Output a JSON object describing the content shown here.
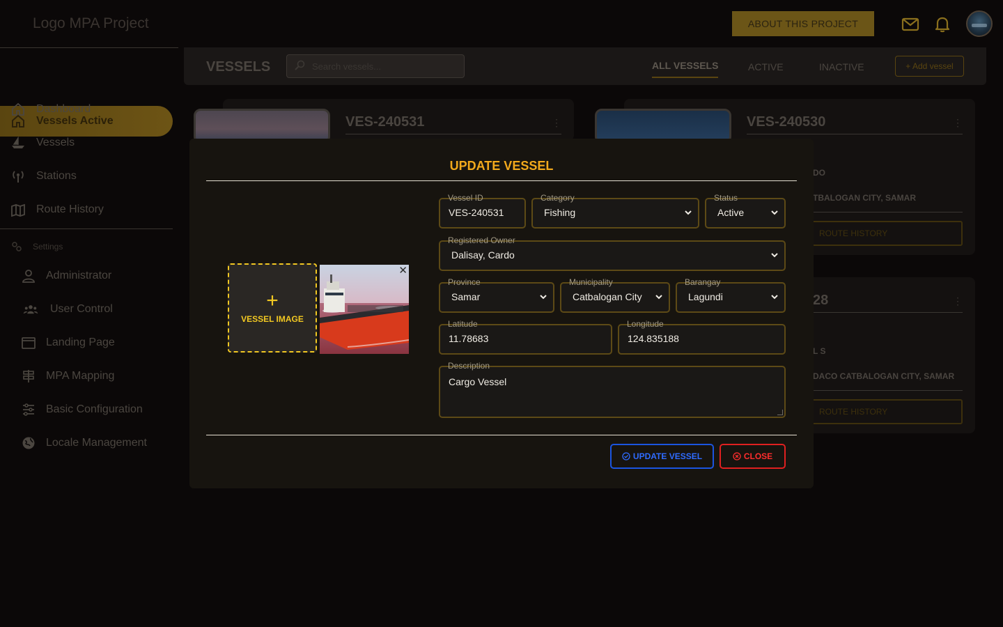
{
  "header": {
    "logo_text": "Logo MPA Project",
    "about_button": "ABOUT THIS PROJECT"
  },
  "sidebar": {
    "active_item": "Vessels Active",
    "items": [
      {
        "label": "Dashboard",
        "icon": "home-icon"
      },
      {
        "label": "Vessels",
        "icon": "ship-icon"
      },
      {
        "label": "Stations",
        "icon": "antenna-icon"
      },
      {
        "label": "Route History",
        "icon": "map-icon"
      }
    ],
    "settings_label": "Settings",
    "settings_items": [
      {
        "label": "Administrator",
        "icon": "user-icon"
      },
      {
        "label": "User Control",
        "icon": "users-icon"
      },
      {
        "label": "Landing Page",
        "icon": "window-icon"
      },
      {
        "label": "MPA Mapping",
        "icon": "signpost-icon"
      },
      {
        "label": "Basic Configuration",
        "icon": "sliders-icon"
      },
      {
        "label": "Locale Management",
        "icon": "globe-icon"
      }
    ]
  },
  "subheader": {
    "title": "VESSELS",
    "search_placeholder": "Search vessels...",
    "tabs": [
      "ALL VESSELS",
      "ACTIVE",
      "INACTIVE"
    ],
    "add_button": "+ Add vessel"
  },
  "cards": [
    {
      "id": "VES-240531"
    },
    {
      "id": "VES-240530",
      "owner_partial": "DO",
      "address_partial": "TBALOGAN CITY, SAMAR",
      "button": "ROUTE HISTORY"
    },
    {
      "id_partial": "28",
      "owner_partial": "L S",
      "address_partial": "DACO CATBALOGAN CITY, SAMAR",
      "button": "ROUTE HISTORY"
    }
  ],
  "modal": {
    "title": "UPDATE VESSEL",
    "image_label": "VESSEL IMAGE",
    "fields": {
      "vessel_id": {
        "label": "Vessel ID",
        "value": "VES-240531"
      },
      "category": {
        "label": "Category",
        "value": "Fishing"
      },
      "status": {
        "label": "Status",
        "value": "Active"
      },
      "owner": {
        "label": "Registered Owner",
        "value": "Dalisay, Cardo"
      },
      "province": {
        "label": "Province",
        "value": "Samar"
      },
      "municipality": {
        "label": "Municipality",
        "value": "Catbalogan City"
      },
      "barangay": {
        "label": "Barangay",
        "value": "Lagundi"
      },
      "latitude": {
        "label": "Latitude",
        "value": "11.78683"
      },
      "longitude": {
        "label": "Longitude",
        "value": "124.835188"
      },
      "description": {
        "label": "Description",
        "value": "Cargo Vessel"
      }
    },
    "update_button": "UPDATE VESSEL",
    "close_button": "CLOSE"
  },
  "colors": {
    "accent": "#f2a91c",
    "gold_border": "#5d4a16",
    "update_blue": "#1b55e0",
    "close_red": "#e02020"
  }
}
